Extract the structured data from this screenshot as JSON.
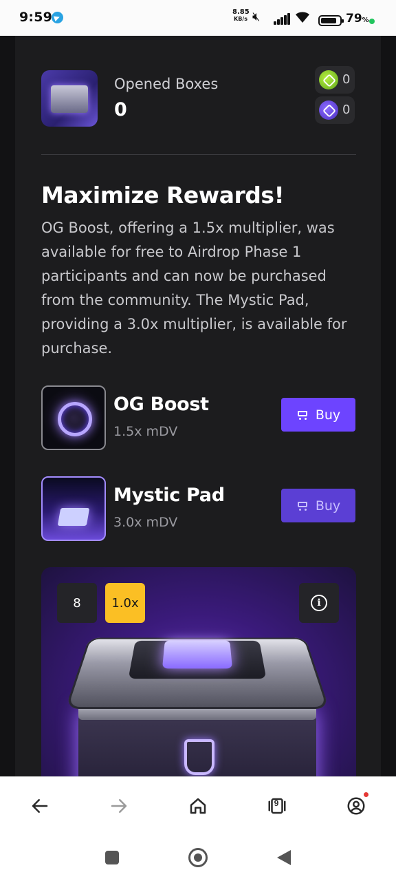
{
  "status_bar": {
    "time": "9:59",
    "net_speed": "8.85",
    "net_speed_unit": "KB/s",
    "battery_percent": "79",
    "battery_unit": "%"
  },
  "header": {
    "opened_label": "Opened Boxes",
    "opened_value": "0",
    "tokens": [
      {
        "icon": "green-token-icon",
        "color": "#7cc62b",
        "value": "0"
      },
      {
        "icon": "purple-token-icon",
        "color": "#6b46e6",
        "value": "0"
      }
    ]
  },
  "promo": {
    "title": "Maximize Rewards!",
    "description": "OG Boost, offering a 1.5x multiplier, was available for free to Airdrop Phase 1 participants and can now be purchased from the community. The Mystic Pad, providing a 3.0x multiplier, is available for purchase."
  },
  "products": [
    {
      "name": "OG Boost",
      "multiplier": "1.5x mDV",
      "buy_label": "Buy"
    },
    {
      "name": "Mystic Pad",
      "multiplier": "3.0x mDV",
      "buy_label": "Buy"
    }
  ],
  "box_card": {
    "count": "8",
    "multiplier": "1.0x",
    "info_icon": "info-icon"
  },
  "browser_bar": {
    "tabs_count": "9"
  },
  "colors": {
    "accent": "#6d44ff",
    "badge_yellow": "#fbbf24",
    "card_bg": "#1c1c1e"
  }
}
